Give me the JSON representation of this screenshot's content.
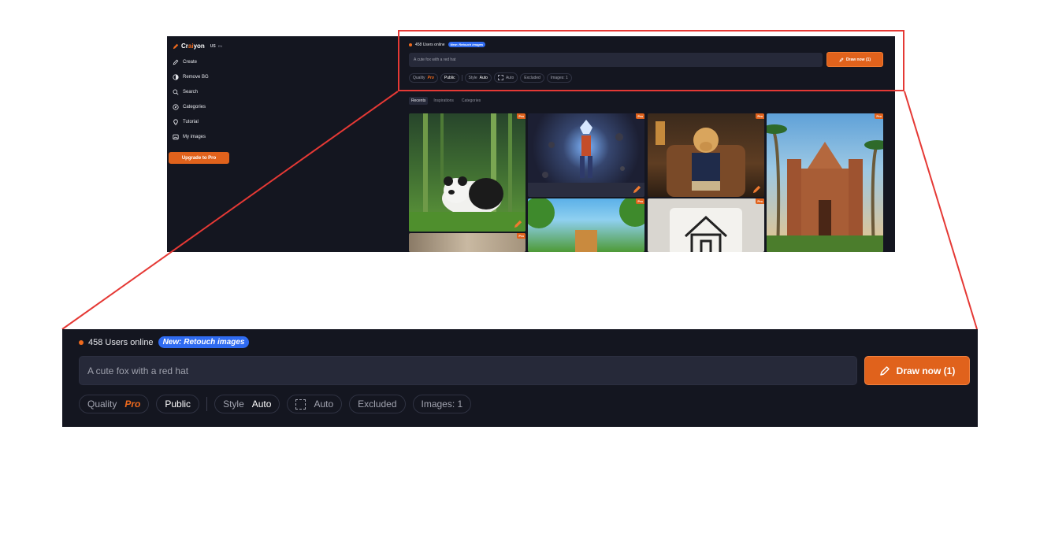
{
  "brand": {
    "prefix": "Cr",
    "accent": "ai",
    "suffix": "yon",
    "country": "US",
    "lang": "EN"
  },
  "sidebar": {
    "items": [
      {
        "label": "Create",
        "icon": "pencil-icon"
      },
      {
        "label": "Remove BG",
        "icon": "half-circle-icon"
      },
      {
        "label": "Search",
        "icon": "search-icon"
      },
      {
        "label": "Categories",
        "icon": "compass-icon"
      },
      {
        "label": "Tutorial",
        "icon": "bulb-icon"
      },
      {
        "label": "My images",
        "icon": "image-icon"
      }
    ],
    "upgrade_label": "Upgrade to Pro"
  },
  "header": {
    "online_text": "458 Users online",
    "badge": "New: Retouch images"
  },
  "prompt": {
    "placeholder": "A cute fox with a red hat",
    "draw_label": "Draw now (1)"
  },
  "options": {
    "quality_label": "Quality",
    "quality_value": "Pro",
    "visibility": "Public",
    "style_label": "Style",
    "style_value": "Auto",
    "aspect_value": "Auto",
    "excluded": "Excluded",
    "images": "Images: 1"
  },
  "tabs": [
    "Recents",
    "Inspirations",
    "Categories"
  ],
  "gallery": {
    "pro_tag": "Pro"
  },
  "colors": {
    "accent": "#e0621c",
    "bg": "#141620",
    "badge": "#2f6bf1",
    "callout": "#e53935"
  }
}
